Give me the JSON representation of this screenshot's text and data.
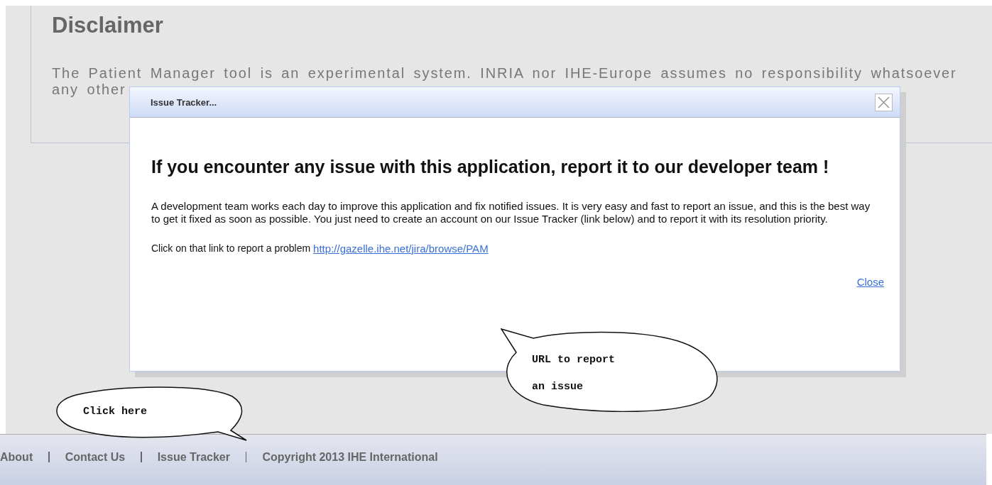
{
  "disclaimer": {
    "title": "Disclaimer",
    "lines": [
      "The Patient Manager tool is an experimental system. INRIA nor IHE-Europe assumes no responsibility whatsoever",
      "any other"
    ]
  },
  "dialog": {
    "title": "Issue Tracker...",
    "heading": "If you encounter any issue with this application, report it to our developer team !",
    "body": "A development team works each day to improve this application and fix notified issues. It is very easy and fast to report an issue, and this is the best way to get it fixed as soon as possible. You just need to create an account on our Issue Tracker (link below) and to report it with its resolution priority.",
    "link_prompt": "Click on that link to report a problem",
    "link": "http://gazelle.ihe.net/jira/browse/PAM",
    "close_link": "Close"
  },
  "callouts": [
    {
      "text": "URL to report an issue",
      "kind": "tail-up"
    },
    {
      "text": "Click here",
      "kind": "tail-down"
    }
  ],
  "footer": {
    "links": [
      "About",
      "Contact Us",
      "Issue Tracker"
    ],
    "copyright": "Copyright 2013 IHE International"
  }
}
